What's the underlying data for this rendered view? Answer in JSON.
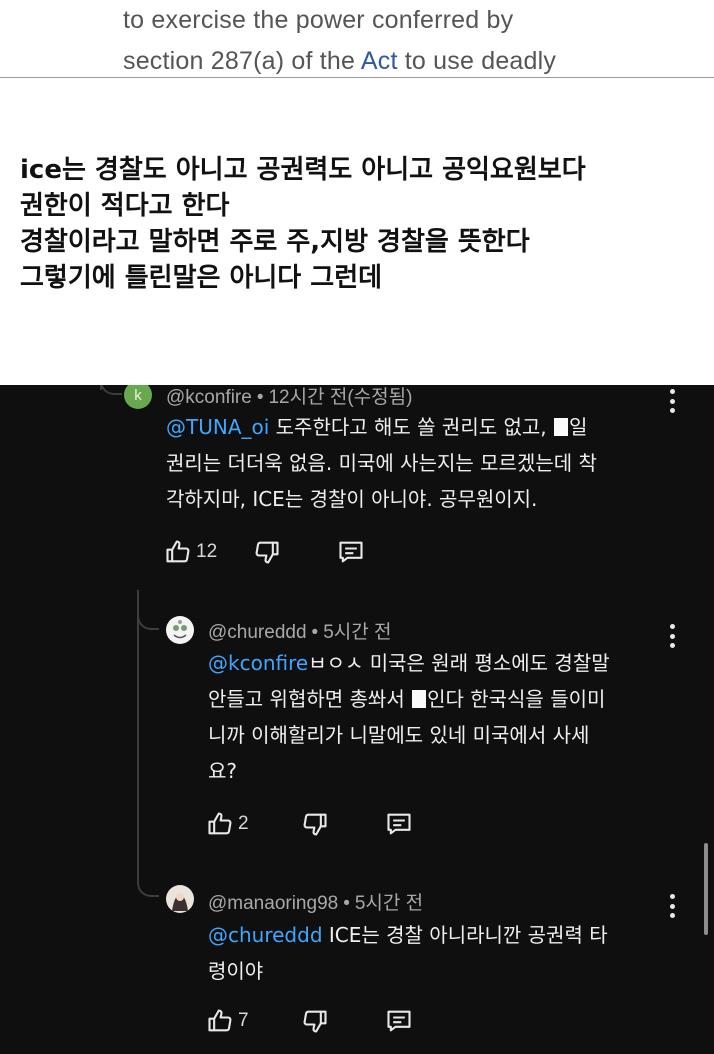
{
  "doc": {
    "line1": "to exercise the power conferred by",
    "line2_pre": "section 287(a) of the ",
    "line2_link": "Act",
    "line2_post": " to use deadly"
  },
  "caption": {
    "lines": [
      "ice는 경찰도 아니고 공권력도 아니고 공익요원보다",
      "권한이 적다고 한다",
      "경찰이라고 말하면 주로 주,지방 경찰을 뜻한다",
      "그렇기에 틀린말은 아니다 그런데"
    ]
  },
  "comments": [
    {
      "avatar_letter": "k",
      "avatar_color": "#6aa84f",
      "author": "@kconfire",
      "sep": "•",
      "time": "12시간 전(수정됨)",
      "lines": [
        {
          "mention": "@TUNA_oi",
          "text": " 도주한다고 해도 쏠 권리도 없고, ",
          "after": "일"
        },
        {
          "text": "권리는 더더욱 없음. 미국에 사는지는 모르겠는데 착"
        },
        {
          "text": "각하지마, ICE는 경찰이 아니야. 공무원이지."
        }
      ],
      "likes": "12"
    },
    {
      "author": "@chureddd",
      "sep": "•",
      "time": "5시간 전",
      "lines": [
        {
          "mention": "@kconfire",
          "text": "ㅂㅇㅅ 미국은 원래 평소에도 경찰말"
        },
        {
          "text": "안들고 위협하면 총쏴서 ",
          "after": "인다 한국식을 들이미"
        },
        {
          "text": "니까 이해할리가 니말에도 있네 미국에서 사세"
        },
        {
          "text": "요?"
        }
      ],
      "likes": "2"
    },
    {
      "author": "@manaoring98",
      "sep": "•",
      "time": "5시간 전",
      "lines": [
        {
          "mention": "@chureddd",
          "text": " ICE는 경찰 아니라니깐 공권력 타"
        },
        {
          "text": "령이야"
        }
      ],
      "likes": "7"
    }
  ],
  "icons": {
    "like": "thumb-up-icon",
    "dislike": "thumb-down-icon",
    "reply": "reply-icon",
    "more": "kebab-icon"
  },
  "colors": {
    "mention": "#3ea6ff",
    "panel_bg": "#0f0f0f",
    "link": "#2f57a7"
  }
}
